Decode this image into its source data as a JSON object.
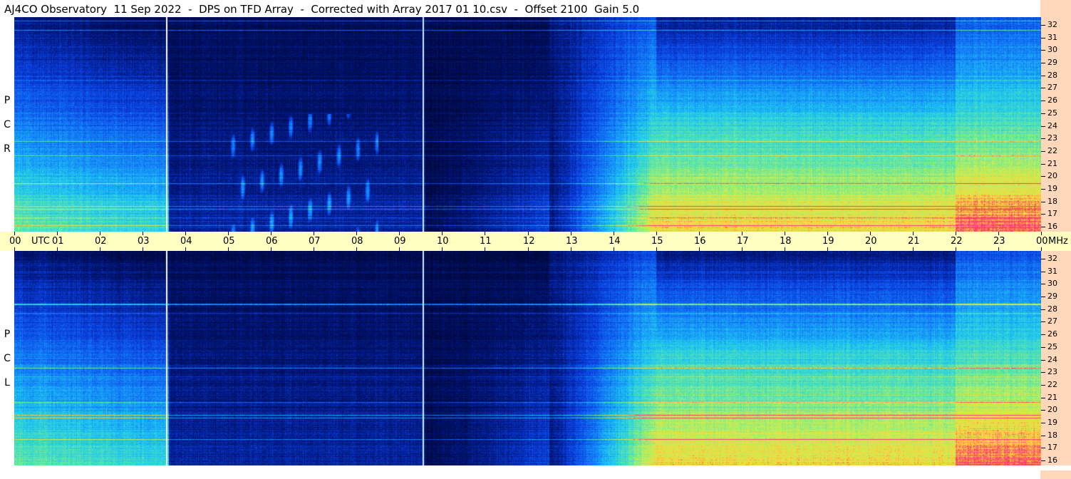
{
  "title": "AJ4CO Observatory  11 Sep 2022  -  DPS on TFD Array  -  Corrected with Array 2017 01 10.csv  -  Offset 2100  Gain 5.0",
  "chart_data": [
    {
      "type": "heatmap",
      "name": "R C P",
      "polarization_letters": [
        "R",
        "C",
        "P"
      ],
      "x_tick_labels": [
        "00",
        "01",
        "02",
        "03",
        "04",
        "05",
        "06",
        "07",
        "08",
        "09",
        "10",
        "11",
        "12",
        "13",
        "14",
        "15",
        "16",
        "17",
        "18",
        "19",
        "20",
        "21",
        "22",
        "23",
        "00"
      ],
      "x_unit_labels": {
        "start": "UTC",
        "end": "MHz"
      },
      "xlim": [
        0,
        24
      ],
      "y_tick_labels": [
        "32",
        "31",
        "30",
        "29",
        "28",
        "27",
        "26",
        "25",
        "24",
        "23",
        "22",
        "21",
        "20",
        "19",
        "18",
        "17",
        "16"
      ],
      "ylim": [
        16,
        32
      ],
      "colors": {
        "low": "#000a40",
        "mid": "#1a5cff",
        "high": "#ffe04a",
        "peak": "#ff2060"
      }
    },
    {
      "type": "heatmap",
      "name": "L C P",
      "polarization_letters": [
        "L",
        "C",
        "P"
      ],
      "xlim": [
        0,
        24
      ],
      "y_tick_labels": [
        "32",
        "31",
        "30",
        "29",
        "28",
        "27",
        "26",
        "25",
        "24",
        "23",
        "22",
        "21",
        "20",
        "19",
        "18",
        "17",
        "16"
      ],
      "ylim": [
        16,
        32
      ]
    }
  ]
}
